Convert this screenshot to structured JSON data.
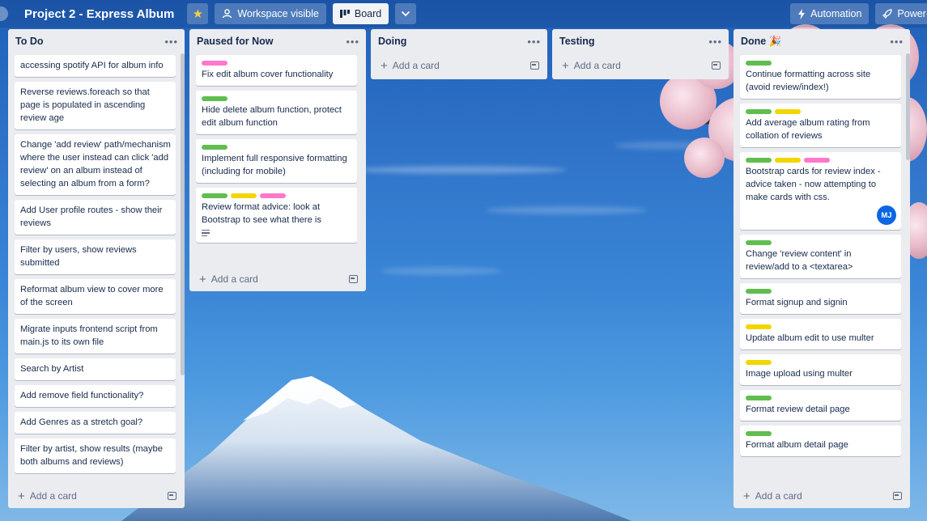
{
  "board": {
    "title": "Project 2 - Express Album",
    "star_icon": "star-icon",
    "visibility_label": "Workspace visible",
    "view_label": "Board",
    "automation_label": "Automation",
    "powerups_label": "Power-"
  },
  "lists": [
    {
      "title": "To Do",
      "add_label": "Add a card",
      "cards": [
        {
          "text": "accessing spotify API for album info",
          "labels": []
        },
        {
          "text": "Reverse reviews.foreach so that page is populated in ascending review age",
          "labels": []
        },
        {
          "text": "Change 'add review' path/mechanism where the user instead can click 'add review' on an album instead of selecting an album from a form?",
          "labels": []
        },
        {
          "text": "Add User profile routes - show their reviews",
          "labels": []
        },
        {
          "text": "Filter by users, show reviews submitted",
          "labels": []
        },
        {
          "text": "Reformat album view to cover more of the screen",
          "labels": []
        },
        {
          "text": "Migrate inputs frontend script from main.js to its own file",
          "labels": []
        },
        {
          "text": "Search by Artist",
          "labels": []
        },
        {
          "text": "Add remove field functionality?",
          "labels": []
        },
        {
          "text": "Add Genres as a stretch goal?",
          "labels": []
        },
        {
          "text": "Filter by artist, show results (maybe both albums and reviews)",
          "labels": []
        }
      ]
    },
    {
      "title": "Paused for Now",
      "add_label": "Add a card",
      "cards": [
        {
          "text": "Fix edit album cover functionality",
          "labels": [
            "pink"
          ]
        },
        {
          "text": "Hide delete album function, protect edit album function",
          "labels": [
            "green"
          ]
        },
        {
          "text": "Implement full responsive formatting (including for mobile)",
          "labels": [
            "green"
          ]
        },
        {
          "text": "Review format advice: look at Bootstrap to see what there is",
          "labels": [
            "green",
            "yellow",
            "pink"
          ],
          "has_description": true
        }
      ]
    },
    {
      "title": "Doing",
      "add_label": "Add a card",
      "cards": []
    },
    {
      "title": "Testing",
      "add_label": "Add a card",
      "cards": []
    },
    {
      "title": "Done 🎉",
      "add_label": "Add a card",
      "cards": [
        {
          "text": "Continue formatting across site (avoid review/index!)",
          "labels": [
            "green"
          ]
        },
        {
          "text": "Add average album rating from collation of reviews",
          "labels": [
            "green",
            "yellow"
          ]
        },
        {
          "text": "Bootstrap cards for review index - advice taken - now attempting to make cards with css.",
          "labels": [
            "green",
            "yellow",
            "pink"
          ],
          "member": "MJ"
        },
        {
          "text": "Change 'review content' in review/add to a <textarea>",
          "labels": [
            "green"
          ]
        },
        {
          "text": "Format signup and signin",
          "labels": [
            "green"
          ]
        },
        {
          "text": "Update album edit to use multer",
          "labels": [
            "yellow"
          ]
        },
        {
          "text": "Image upload using multer",
          "labels": [
            "yellow"
          ]
        },
        {
          "text": "Format review detail page",
          "labels": [
            "green"
          ]
        },
        {
          "text": "Format album detail page",
          "labels": [
            "green"
          ]
        }
      ]
    }
  ],
  "colors": {
    "green": "#61bd4f",
    "yellow": "#f2d600",
    "pink": "#ff78cb",
    "list_bg": "#ebecf0",
    "avatar": "#0c66e4"
  }
}
